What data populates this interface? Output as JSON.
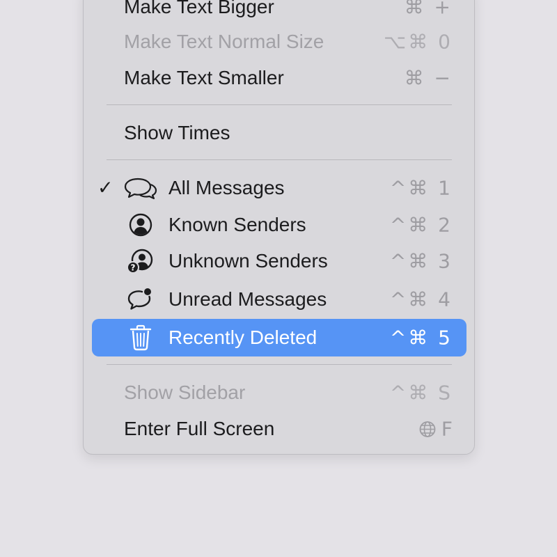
{
  "menu": {
    "items": [
      {
        "label": "Make Text Bigger",
        "shortcut": "⌘ +",
        "enabled": true
      },
      {
        "label": "Make Text Normal Size",
        "shortcut": "⌥⌘ 0",
        "enabled": false
      },
      {
        "label": "Make Text Smaller",
        "shortcut": "⌘ −",
        "enabled": true
      },
      {
        "label": "Show Times",
        "shortcut": "",
        "enabled": true
      },
      {
        "label": "All Messages",
        "shortcut": "^⌘ 1",
        "enabled": true,
        "checked": true,
        "icon": "chat-bubbles-icon"
      },
      {
        "label": "Known Senders",
        "shortcut": "^⌘ 2",
        "enabled": true,
        "icon": "person-circle-icon"
      },
      {
        "label": "Unknown Senders",
        "shortcut": "^⌘ 3",
        "enabled": true,
        "icon": "person-question-icon"
      },
      {
        "label": "Unread Messages",
        "shortcut": "^⌘ 4",
        "enabled": true,
        "icon": "chat-bubble-dot-icon"
      },
      {
        "label": "Recently Deleted",
        "shortcut": "^⌘ 5",
        "enabled": true,
        "selected": true,
        "icon": "trash-icon"
      },
      {
        "label": "Show Sidebar",
        "shortcut": "^⌘ S",
        "enabled": false
      },
      {
        "label": "Enter Full Screen",
        "shortcut": "F",
        "enabled": true,
        "shortcut_icon": "globe-icon"
      }
    ],
    "checkmark": "✓"
  },
  "colors": {
    "background": "#e4e2e7",
    "menu_background": "#d9d8dc",
    "selection": "#5694f5",
    "text": "#1c1c1e",
    "disabled_text": "#a2a1a6",
    "shortcut_text": "#9e9da2"
  }
}
